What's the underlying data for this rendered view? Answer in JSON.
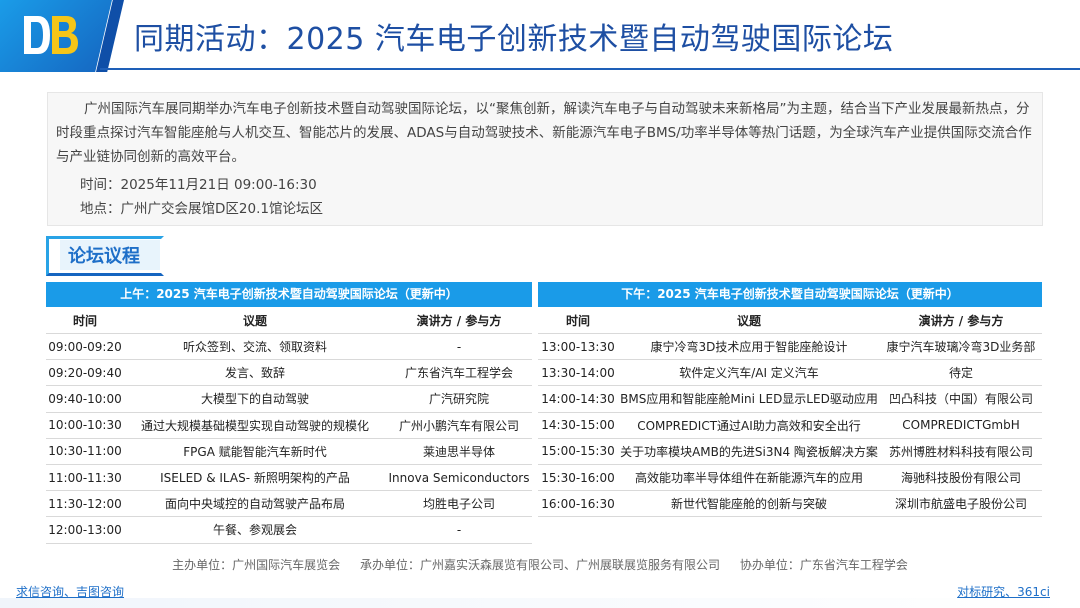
{
  "header": {
    "title": "同期活动：2025 汽车电子创新技术暨自动驾驶国际论坛",
    "accent_color": "#1e4fa3",
    "logo_icon": "db-logo-icon"
  },
  "intro": {
    "description": "广州国际汽车展同期举办汽车电子创新技术暨自动驾驶国际论坛，以“聚焦创新，解读汽车电子与自动驾驶未来新格局”为主题，结合当下产业发展最新热点，分时段重点探讨汽车智能座舱与人机交互、智能芯片的发展、ADAS与自动驾驶技术、新能源汽车电子BMS/功率半导体等热门话题，为全球汽车产业提供国际交流合作与产业链协同创新的高效平台。",
    "time": "时间：2025年11月21日 09:00-16:30",
    "place": "地点：广州广交会展馆D区20.1馆论坛区"
  },
  "section_label": "论坛议程",
  "morning": {
    "title": "上午：2025 汽车电子创新技术暨自动驾驶国际论坛（更新中）",
    "headers": [
      "时间",
      "议题",
      "演讲方 / 参与方"
    ],
    "rows": [
      [
        "09:00-09:20",
        "听众签到、交流、领取资料",
        "-"
      ],
      [
        "09:20-09:40",
        "发言、致辞",
        "广东省汽车工程学会"
      ],
      [
        "09:40-10:00",
        "大模型下的自动驾驶",
        "广汽研究院"
      ],
      [
        "10:00-10:30",
        "通过大规模基础模型实现自动驾驶的规模化",
        "广州小鹏汽车有限公司"
      ],
      [
        "10:30-11:00",
        "FPGA 赋能智能汽车新时代",
        "莱迪思半导体"
      ],
      [
        "11:00-11:30",
        "ISELED & ILAS- 新照明架构的产品",
        "Innova Semiconductors"
      ],
      [
        "11:30-12:00",
        "面向中央域控的自动驾驶产品布局",
        "均胜电子公司"
      ],
      [
        "12:00-13:00",
        "午餐、参观展会",
        "-"
      ]
    ]
  },
  "afternoon": {
    "title": "下午：2025 汽车电子创新技术暨自动驾驶国际论坛（更新中）",
    "headers": [
      "时间",
      "议题",
      "演讲方 / 参与方"
    ],
    "rows": [
      [
        "13:00-13:30",
        "康宁冷弯3D技术应用于智能座舱设计",
        "康宁汽车玻璃冷弯3D业务部"
      ],
      [
        "13:30-14:00",
        "软件定义汽车/AI 定义汽车",
        "待定"
      ],
      [
        "14:00-14:30",
        "BMS应用和智能座舱Mini LED显示LED驱动应用",
        "凹凸科技（中国）有限公司"
      ],
      [
        "14:30-15:00",
        "COMPREDICT通过AI助力高效和安全出行",
        "COMPREDICTGmbH"
      ],
      [
        "15:00-15:30",
        "关于功率模块AMB的先进Si3N4 陶瓷板解决方案",
        "苏州博胜材料科技有限公司"
      ],
      [
        "15:30-16:00",
        "高效能功率半导体组件在新能源汽车的应用",
        "海驰科技股份有限公司"
      ],
      [
        "16:00-16:30",
        "新世代智能座舱的创新与突破",
        "深圳市航盛电子股份公司"
      ]
    ]
  },
  "organizers": {
    "host": "主办单位：广州国际汽车展览会",
    "organizer": "承办单位：广州嘉实沃森展览有限公司、广州展联展览服务有限公司",
    "co": "协办单位：广东省汽车工程学会"
  },
  "footer": {
    "left_link": "求信咨询、吉图咨询",
    "right_link": "对标研究、361ci"
  }
}
